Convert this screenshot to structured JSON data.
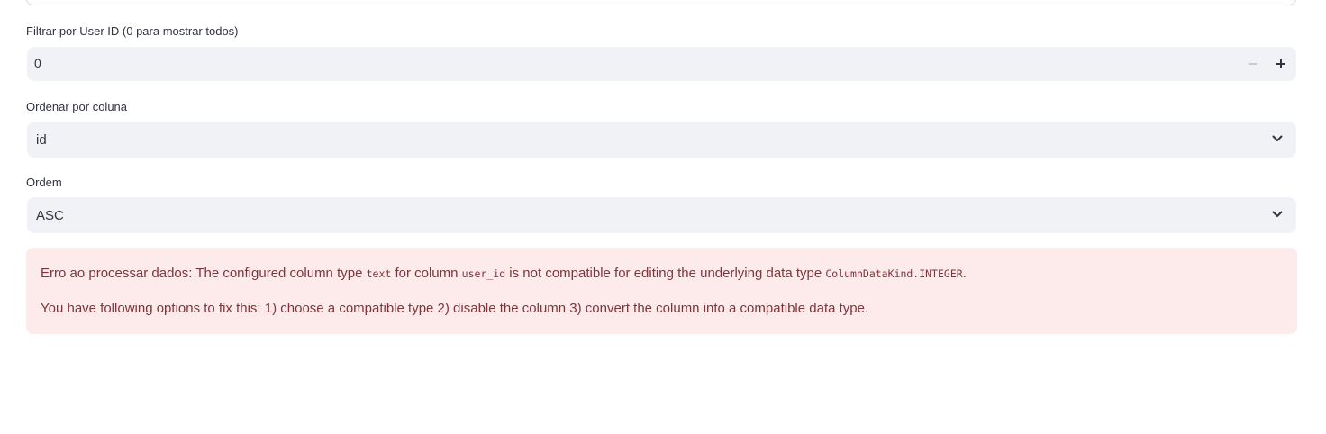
{
  "filters": {
    "user_id": {
      "label": "Filtrar por User ID (0 para mostrar todos)",
      "value": "0",
      "decrement_icon": "minus-icon",
      "increment_icon": "plus-icon"
    },
    "sort_column": {
      "label": "Ordenar por coluna",
      "selected": "id",
      "icon": "chevron-down-icon"
    },
    "sort_order": {
      "label": "Ordem",
      "selected": "ASC",
      "icon": "chevron-down-icon"
    }
  },
  "error": {
    "prefix": "Erro ao processar dados: The configured column type ",
    "column_type": "text",
    "mid1": " for column ",
    "column_name": "user_id",
    "mid2": " is not compatible for editing the underlying data type ",
    "data_type": "ColumnDataKind.INTEGER",
    "suffix": ".",
    "options": "You have following options to fix this: 1) choose a compatible type 2) disable the column 3) convert the column into a compatible data type."
  },
  "colors": {
    "input_bg": "#f0f2f6",
    "error_bg": "#fdeaea",
    "error_text": "#7d353b",
    "text": "#31333f"
  }
}
